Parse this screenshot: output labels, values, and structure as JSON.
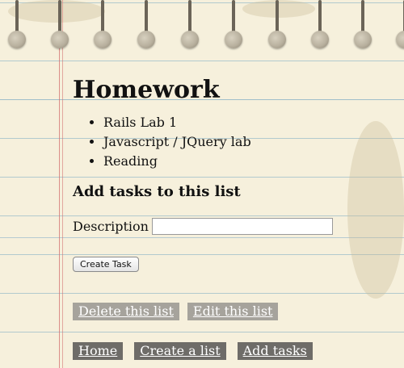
{
  "list": {
    "title": "Homework",
    "tasks": [
      "Rails Lab 1",
      "Javascript / JQuery lab",
      "Reading"
    ]
  },
  "form": {
    "heading": "Add tasks to this list",
    "description_label": "Description",
    "description_value": "",
    "submit_label": "Create Task"
  },
  "list_actions": {
    "delete_label": "Delete this list",
    "edit_label": "Edit this list"
  },
  "nav": {
    "home_label": "Home",
    "create_list_label": "Create a list",
    "add_tasks_label": "Add tasks"
  },
  "colors": {
    "paper": "#f6f0dc",
    "margin_line": "#d26e6e",
    "rule_line": "#96b9c8",
    "light_button": "#a6a39c",
    "dark_button": "#6e6c68"
  }
}
